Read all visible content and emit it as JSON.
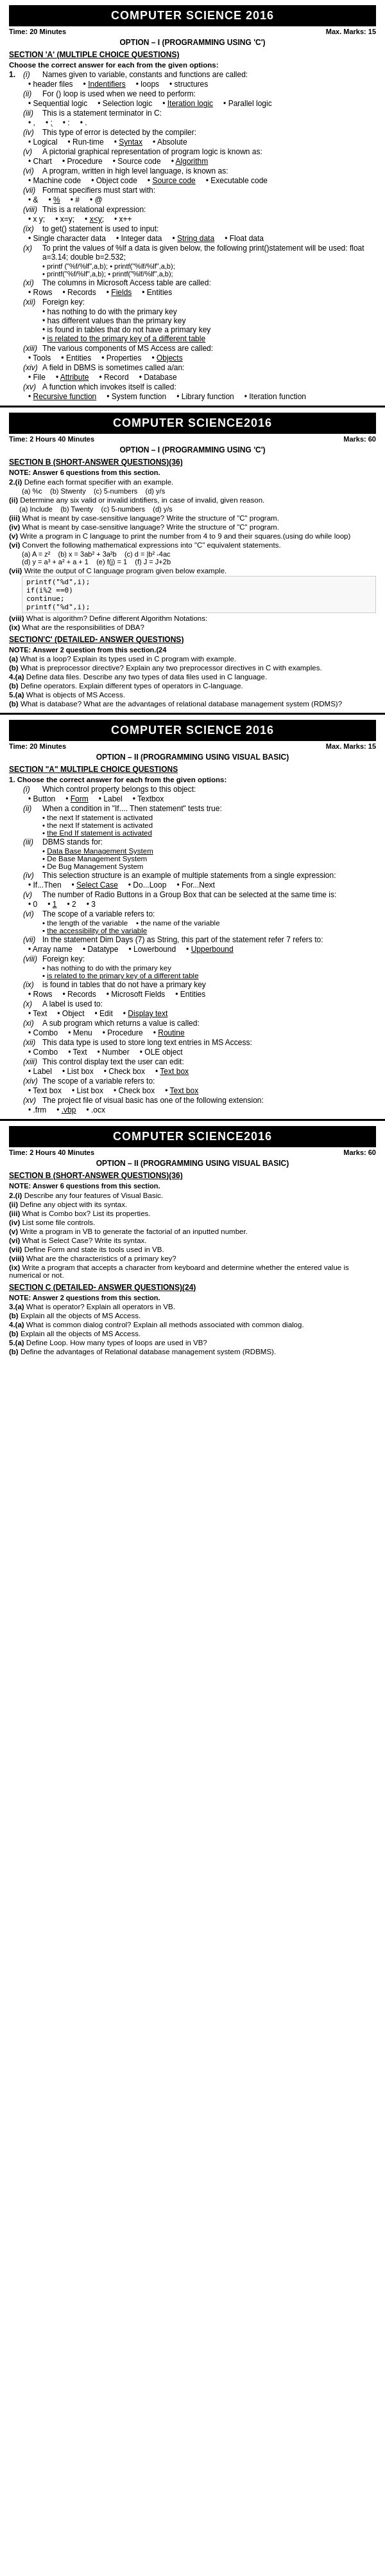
{
  "pages": [
    {
      "title": "COMPUTER SCIENCE 2016",
      "meta": {
        "time": "Time: 20 Minutes",
        "marks": "Max. Marks: 15"
      },
      "option": "OPTION – I    (PROGRAMMING USING 'C')",
      "sectionA": {
        "title": "SECTION 'A' (MULTIPLE CHOICE QUESTIONS)",
        "note": "Choose the correct answer for each from the given options:",
        "questions": [
          {
            "num": "1.",
            "roman": "(i)",
            "text": "Names given to variable, constants and functions are called:",
            "options": [
              "header files",
              "Indentifiers",
              "loops",
              "structures"
            ]
          },
          {
            "roman": "(ii)",
            "text": "For () loop is used when we need to perform:",
            "options": [
              "Sequential logic",
              "Selection logic",
              "Iteration logic",
              "Parallel logic"
            ]
          },
          {
            "roman": "(iii)",
            "text": "This is a statement terminator in C:",
            "options": [
              ",",
              ";",
              ":",
              "."
            ]
          },
          {
            "roman": "(iv)",
            "text": "This type of error is detected by the compiler:",
            "options": [
              "Logical",
              "Run-time",
              "Syntax",
              "Absolute"
            ]
          },
          {
            "roman": "(v)",
            "text": "A pictorial graphical representation of program logic is known as:",
            "options": [
              "Chart",
              "Procedure",
              "Source code",
              "Algorithm"
            ]
          },
          {
            "roman": "(vi)",
            "text": "A program, written in high level language, is known as:",
            "options": [
              "Machine code",
              "Object code",
              "Source code",
              "Executable code"
            ]
          },
          {
            "roman": "(vii)",
            "text": "Format specifiers must start with:",
            "options": [
              "&",
              "%",
              "#",
              "@"
            ]
          },
          {
            "roman": "(viii)",
            "text": "This is a relational expression:",
            "options": [
              "x y;",
              "x=y;",
              "x<y;",
              "x++"
            ]
          },
          {
            "roman": "(ix)",
            "text": "to get() statement is used to input:",
            "options": [
              "Single character data",
              "Integer data",
              "String data",
              "Float data"
            ]
          },
          {
            "roman": "(x)",
            "text": "To print the values of %lf a data is given below, the following print()statement will be used: float a=3.14; double b=2.532;",
            "sub": [
              "printf (\"%f/%lf\",a,b);",
              "printf(\"%lf/%lf\",a,b);",
              "printf(\"%f/%lf\",a,b);",
              "printf(\"%lf/%lf\",a,b);"
            ]
          },
          {
            "roman": "(xi)",
            "text": "The columns in Microsoft Access table are called:",
            "options": [
              "Rows",
              "Records",
              "Fields",
              "Entities"
            ]
          },
          {
            "roman": "(xii)",
            "text": "Foreign key:",
            "options": [
              "has nothing to do with the primary key",
              "has different values than the primary key",
              "is found in tables that do not have a primary key",
              "is related to the primary key of a different table"
            ]
          },
          {
            "roman": "(xiii)",
            "text": "The various components of MS Access are called:",
            "options": [
              "Tools",
              "Entities",
              "Properties",
              "Objects"
            ]
          },
          {
            "roman": "(xiv)",
            "text": "A field in DBMS is sometimes called a/an:",
            "options": [
              "File",
              "Attribute",
              "Record",
              "Database"
            ]
          },
          {
            "roman": "(xv)",
            "text": "A function which invokes itself is called:",
            "options": [
              "Recursive function",
              "System function",
              "Library function",
              "Iteration function"
            ]
          }
        ]
      }
    },
    {
      "title": "COMPUTER SCIENCE2016",
      "meta": {
        "time": "Time: 2 Hours 40 Minutes",
        "marks": "Marks: 60"
      },
      "option": "OPTION – I    (PROGRAMMING USING 'C')",
      "sectionB": {
        "title": "SECTION B (SHORT-ANSWER QUESTIONS)(36)",
        "note": "NOTE: Answer 6 questions from this section.",
        "note2": "2.(i) Define each format specifier with an example.",
        "questions_b": [
          {
            "parts": [
              {
                "label": "(a)",
                "text": "%c"
              },
              {
                "label": "(b)",
                "text": "Stwenty"
              },
              {
                "label": "(c)",
                "text": "5-numbers"
              },
              {
                "label": "(d)",
                "text": "y/s"
              }
            ]
          },
          {
            "text": "(ii) Determine any six valid or invalid idntifiers, in case of invalid, given reason."
          },
          {
            "text": "(iii) (a) Include (b) Twenty (c) 5-numbers (d) y/s"
          },
          {
            "text": "(iv) What is meant by case-sensitive language? Write the structure of \"C\" program."
          },
          {
            "text": "(v) Write a program in C language to print the number from 4 to 9 and their squares.(using do while loop)"
          },
          {
            "text": "(vi) Convert the following mathematical expressions into \"C\" equivalent statements.",
            "sub": [
              "(a) A = z² (b) x = 3ab² + 3a²b (c) d = |b² - 4ac",
              "(d) y = a³ + a² + a + 1 (e) f(j) = 1 (f) J = J+2b"
            ]
          },
          {
            "text": "(vii) Write the output of C language program given below example.",
            "code": "printf(\"%d\",i);\nif(i%2 ==0)\ncontinue;\nprintf(\"%d\",i);"
          },
          {
            "text": "(viii) What is algorithm? Define different Algorithm Notations:"
          },
          {
            "text": "(ix) What are the responsibilities of DBA?"
          }
        ]
      },
      "sectionC": {
        "title": "SECTION'C' (DETAILED- ANSWER QUESTIONS)",
        "note": "NOTE: Answer 2 question from this section.(24",
        "note2": "(a) What is a loop? Explain its types used in C program with example.",
        "note3": "(b) What is preprocessor directive? Explain any two preprocessor directives in C with examples.",
        "questions_c": [
          {
            "num": "4.(a)",
            "text": "Define data files. Describe any two types of data files used in C language."
          },
          {
            "num": "(b)",
            "text": "Define operators. Explain different types of operators in C-language."
          },
          {
            "num": "5.(a)",
            "text": "What is objects of MS Access."
          },
          {
            "num": "(b)",
            "text": "What is database? What are the advantages of relational database management system (RDMS)?"
          }
        ]
      }
    },
    {
      "title": "COMPUTER SCIENCE  2016",
      "meta": {
        "time": "Time: 20 Minutes",
        "marks": "Max. Marks: 15"
      },
      "option": "OPTION – II   (PROGRAMMING USING VISUAL BASIC)",
      "sectionA": {
        "title": "SECTION \"A\" MULTIPLE CHOICE QUESTIONS",
        "note": "1.    Choose the correct answer for each from the given options:",
        "questions": [
          {
            "roman": "(i)",
            "text": "Which control property belongs to this object:",
            "options": [
              "Button",
              "Form",
              "Label",
              "Textbox"
            ]
          },
          {
            "roman": "(ii)",
            "text": "When a condition in \"If.... Then statement\" tests true:",
            "options": [
              "the next If statement is activated",
              "the next If statement is activated",
              "the End If statement is activated"
            ]
          },
          {
            "roman": "(iii)",
            "text": "DBMS stands for:",
            "options": [
              "Data Base Management System",
              "De Base Management System",
              "De Bug Management System"
            ]
          },
          {
            "roman": "(iv)",
            "text": "This selection structure is an example of multiple statements from a single expression:",
            "options": [
              "If...Then",
              "Select Case",
              "Do...Loop",
              "For...Next"
            ]
          },
          {
            "roman": "(v)",
            "text": "The number of Radio Buttons in a Group Box that can be selected at the same time is:",
            "options": [
              "0",
              "1",
              "2",
              "3"
            ]
          },
          {
            "roman": "(vi)",
            "text": "The scope of a variable refers to:",
            "options": [
              "the length of the variable",
              "the name of the variable",
              "the accessibility of the variable"
            ]
          },
          {
            "roman": "(vii)",
            "text": "In the statement Dim Days (7) as String, this part of the statement refer 7 refers to:",
            "options": [
              "Array name",
              "Datatype",
              "Lowerbound",
              "Upperbound"
            ]
          },
          {
            "roman": "(viii)",
            "text": "Foreign key:",
            "options": [
              "has nothing to do with the primary key",
              "is related to the primary key of a different table"
            ]
          },
          {
            "roman": "(ix)",
            "text": "is found in tables that do not have a primary key",
            "options": [
              "Rows",
              "Records",
              "Microsoft Fields",
              "Entities"
            ]
          },
          {
            "roman": "(x)",
            "text": "A label is used to:",
            "options": [
              "Text",
              "Object",
              "Edit",
              "Display text"
            ]
          },
          {
            "roman": "(xi)",
            "text": "A sub program which returns a value is called:",
            "options": [
              "Combo",
              "Menu",
              "Procedure",
              "Routine"
            ]
          },
          {
            "roman": "(xii)",
            "text": "This data type is used to store long text entries in MS Access:",
            "options": [
              "Combo",
              "Text",
              "Number",
              "OLE object"
            ]
          },
          {
            "roman": "(xiii)",
            "text": "This control display text the user can edit:",
            "options": [
              "Label",
              "List box",
              "Check box",
              "Text box"
            ]
          },
          {
            "roman": "(xiv)",
            "text": "The scope of a variable refers to:",
            "options": [
              "Text box",
              "List box",
              "Check box",
              "Text box"
            ]
          },
          {
            "roman": "(xv)",
            "text": "The project file of visual basic has one of the following extension:",
            "options": [
              ".frm",
              ".vbp",
              ".ocx"
            ]
          }
        ]
      }
    },
    {
      "title": "COMPUTER SCIENCE2016",
      "meta": {
        "time": "Time: 2 Hours 40 Minutes",
        "marks": "Marks: 60"
      },
      "option": "OPTION – II   (PROGRAMMING USING VISUAL BASIC)",
      "sectionB": {
        "title": "SECTION B (SHORT-ANSWER QUESTIONS)(36)",
        "note": "NOTE: Answer 6 questions from this section.",
        "questions": [
          {
            "num": "2.(i)",
            "text": "Describe any four features of Visual Basic."
          },
          {
            "num": "(ii)",
            "text": "Define any object with its syntax."
          },
          {
            "num": "(iii)",
            "text": "What is Combo box? List its properties."
          },
          {
            "num": "(iv)",
            "text": "List some file controls."
          },
          {
            "num": "(v)",
            "text": "Write a program in VB to generate the factorial of an inputted number."
          },
          {
            "num": "(vi)",
            "text": "What is Select Case? Write its syntax."
          },
          {
            "num": "(vii)",
            "text": "Define Form and state its tools used in VB."
          },
          {
            "num": "(viii)",
            "text": "What are the characteristics of a primary key?"
          },
          {
            "num": "(ix)",
            "text": "Write a program that accepts a character from keyboard and determine whether the entered value is numerical or not."
          }
        ]
      },
      "sectionC": {
        "title": "NOTE: Answer 2 questions from this section.",
        "questions": [
          {
            "num": "3.(a)",
            "text": "What is operator? Explain all operators in VB."
          },
          {
            "num": "(b)",
            "text": "Explain all the objects of MS Access."
          },
          {
            "num": "4.(a)",
            "text": "What is common dialog control? Explain all methods associated with common dialog."
          },
          {
            "num": "(b)",
            "text": "Explain all the objects of MS Access."
          },
          {
            "num": "5.(a)",
            "text": "Define Loop. How many types of loops are used in VB?"
          },
          {
            "num": "(b)",
            "text": "Define the advantages of Relational database management system (RDBMS)."
          }
        ]
      }
    }
  ],
  "colors": {
    "header_bg": "#000000",
    "header_text": "#ffffff",
    "body_bg": "#ffffff",
    "body_text": "#000000"
  }
}
